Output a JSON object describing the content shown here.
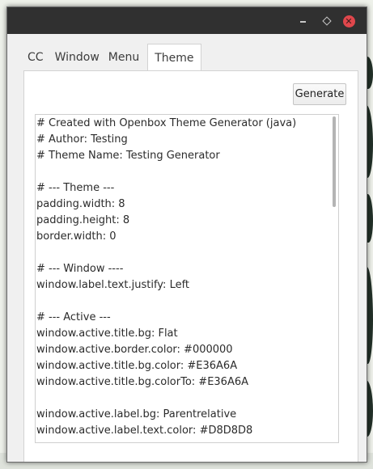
{
  "window": {
    "controls": {
      "minimize_icon": "minimize-icon",
      "maximize_icon": "maximize-icon",
      "close_icon": "close-icon",
      "close_color": "#e0474c"
    }
  },
  "tabs": [
    {
      "label": "CC",
      "active": false
    },
    {
      "label": "Window",
      "active": false
    },
    {
      "label": "Menu",
      "active": false
    },
    {
      "label": "Theme",
      "active": true
    }
  ],
  "toolbar": {
    "generate_label": "Generate"
  },
  "editor": {
    "lines": [
      "# Created with Openbox Theme Generator (java)",
      "# Author: Testing",
      "# Theme Name: Testing Generator",
      "",
      "# --- Theme ---",
      "padding.width: 8",
      "padding.height: 8",
      "border.width: 0",
      "",
      "# --- Window ----",
      "window.label.text.justify: Left",
      "",
      "# --- Active ---",
      "window.active.title.bg: Flat",
      "window.active.border.color: #000000",
      "window.active.title.bg.color: #E36A6A",
      "window.active.title.bg.colorTo: #E36A6A",
      "",
      "window.active.label.bg: Parentrelative",
      "window.active.label.text.color: #D8D8D8"
    ]
  }
}
